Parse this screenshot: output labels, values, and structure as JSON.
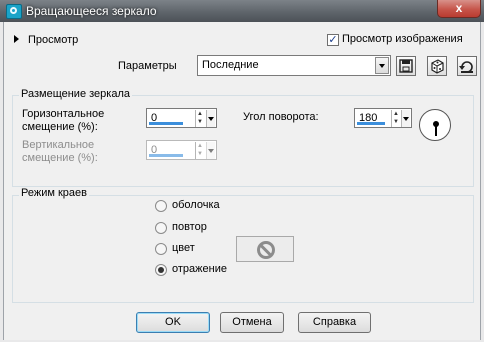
{
  "window": {
    "title": "Вращающееся зеркало",
    "close_glyph": "x"
  },
  "top": {
    "preview_label": "Просмотр",
    "preview_image_label": "Просмотр изображения",
    "preview_image_checked": true,
    "check_glyph": "✓",
    "params_label": "Параметры",
    "params_value": "Последние",
    "icons": [
      "save-preset-icon",
      "dice-randomize-icon",
      "reset-icon"
    ]
  },
  "placement": {
    "label": "Размещение зеркала",
    "horizontal_label_1": "Горизонтальное",
    "horizontal_label_2": "смещение (%):",
    "horizontal_value": "0",
    "vertical_label_1": "Вертикальное",
    "vertical_label_2": "смещение (%):",
    "vertical_value": "0",
    "vertical_enabled": false,
    "rotation_label": "Угол поворота:",
    "rotation_value": "180",
    "up_glyph": "▲",
    "down_glyph": "▼"
  },
  "edge": {
    "label": "Режим краев",
    "options": [
      "оболочка",
      "повтор",
      "цвет",
      "отражение"
    ],
    "selected": "отражение"
  },
  "buttons": {
    "ok": "OK",
    "cancel": "Отмена",
    "help": "Справка"
  },
  "colors": {
    "title_bar": "#5f656b",
    "close_button": "#c6554a",
    "accent_blue": "#3b8edb"
  }
}
